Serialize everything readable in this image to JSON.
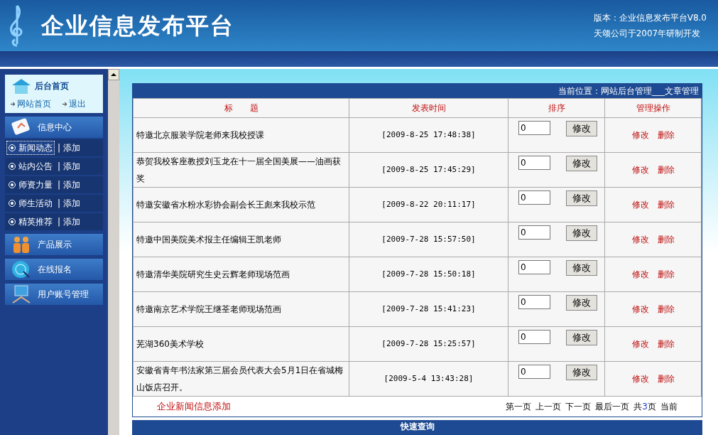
{
  "header": {
    "title": "企业信息发布平台",
    "version": "版本：企业信息发布平台V8.0",
    "credit": "天颂公司于2007年研制开发"
  },
  "sidebar": {
    "home": {
      "title": "后台首页",
      "links": [
        "网站首页",
        "退出"
      ]
    },
    "sections": [
      {
        "kind": "group",
        "label": "信息中心",
        "children": [
          {
            "label": "新闻动态",
            "separator": "|",
            "add": "添加",
            "selected": true
          },
          {
            "label": "站内公告",
            "separator": "|",
            "add": "添加",
            "selected": false
          },
          {
            "label": "师资力量",
            "separator": "|",
            "add": "添加",
            "selected": false
          },
          {
            "label": "师生活动",
            "separator": "|",
            "add": "添加",
            "selected": false
          },
          {
            "label": "精英推荐",
            "separator": "|",
            "add": "添加",
            "selected": false
          }
        ]
      },
      {
        "kind": "link",
        "label": "产品展示"
      },
      {
        "kind": "link",
        "label": "在线报名"
      },
      {
        "kind": "link",
        "label": "用户账号管理"
      }
    ]
  },
  "breadcrumb": "当前位置：网站后台管理___文章管理",
  "table": {
    "columns": [
      "标　　题",
      "发表时间",
      "排序",
      "管理操作"
    ],
    "rows": [
      {
        "title": "特邀北京服装学院老师来我校授课",
        "time": "[2009-8-25 17:48:38]",
        "order": "0",
        "save": "修改",
        "edit": "修改",
        "delete": "删除"
      },
      {
        "title": "恭贺我校客座教授刘玉龙在十一届全国美展——油画获奖",
        "time": "[2009-8-25 17:45:29]",
        "order": "0",
        "save": "修改",
        "edit": "修改",
        "delete": "删除"
      },
      {
        "title": "特邀安徽省水粉水彩协会副会长王彪来我校示范",
        "time": "[2009-8-22 20:11:17]",
        "order": "0",
        "save": "修改",
        "edit": "修改",
        "delete": "删除"
      },
      {
        "title": "特邀中国美院美术报主任编辑王凯老师",
        "time": "[2009-7-28 15:57:50]",
        "order": "0",
        "save": "修改",
        "edit": "修改",
        "delete": "删除"
      },
      {
        "title": "特邀清华美院研究生史云辉老师现场范画",
        "time": "[2009-7-28 15:50:18]",
        "order": "0",
        "save": "修改",
        "edit": "修改",
        "delete": "删除"
      },
      {
        "title": "特邀南京艺术学院王继荃老师现场范画",
        "time": "[2009-7-28 15:41:23]",
        "order": "0",
        "save": "修改",
        "edit": "修改",
        "delete": "删除"
      },
      {
        "title": "芜湖360美术学校",
        "time": "[2009-7-28 15:25:57]",
        "order": "0",
        "save": "修改",
        "edit": "修改",
        "delete": "删除"
      },
      {
        "title": "安徽省青年书法家第三届会员代表大会5月1日在省城梅山饭店召开。",
        "time": "[2009-5-4 13:43:28]",
        "order": "0",
        "save": "修改",
        "edit": "修改",
        "delete": "删除"
      }
    ]
  },
  "footer": {
    "add_link": "企业新闻信息添加",
    "pager": [
      "第一页",
      "上一页",
      "下一页",
      "最后一页"
    ],
    "total_prefix": "共",
    "total_pages": "3",
    "total_suffix": "页",
    "current": "当前"
  },
  "quick_search": {
    "title": "快速查询"
  }
}
